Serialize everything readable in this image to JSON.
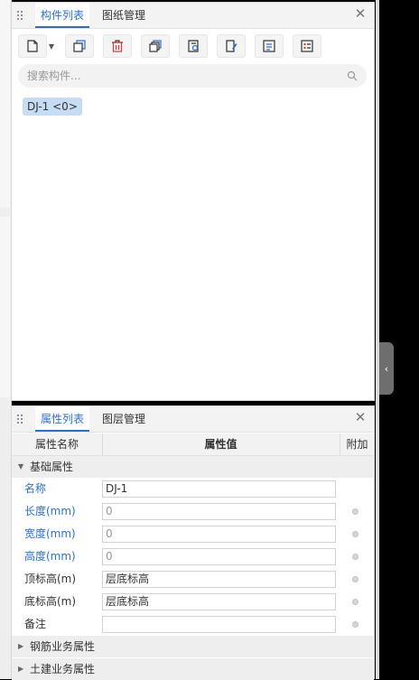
{
  "component_panel": {
    "tabs": [
      {
        "label": "构件列表",
        "active": true
      },
      {
        "label": "图纸管理",
        "active": false
      }
    ],
    "toolbar": [
      "new-component-icon",
      "copy-icon",
      "delete-icon",
      "layer-copy-icon",
      "extract-icon",
      "edit-icon",
      "text-icon",
      "list-icon"
    ],
    "search_placeholder": "搜索构件...",
    "items": [
      {
        "label": "DJ-1 <0>"
      }
    ]
  },
  "property_panel": {
    "tabs": [
      {
        "label": "属性列表",
        "active": true
      },
      {
        "label": "图层管理",
        "active": false
      }
    ],
    "columns": {
      "name": "属性名称",
      "value": "属性值",
      "extra": "附加"
    },
    "groups": {
      "basic": "基础属性",
      "rebar": "钢筋业务属性",
      "civil": "土建业务属性"
    },
    "rows": [
      {
        "name": "名称",
        "value": "DJ-1",
        "blue": true
      },
      {
        "name": "长度(mm)",
        "value": "0",
        "blue": true
      },
      {
        "name": "宽度(mm)",
        "value": "0",
        "blue": true
      },
      {
        "name": "高度(mm)",
        "value": "0",
        "blue": true
      },
      {
        "name": "顶标高(m)",
        "value": "层底标高",
        "blue": false
      },
      {
        "name": "底标高(m)",
        "value": "层底标高",
        "blue": false
      },
      {
        "name": "备注",
        "value": "",
        "blue": false
      }
    ]
  },
  "colors": {
    "accent": "#2b6fd6",
    "chip_bg": "#c5dcf3"
  }
}
